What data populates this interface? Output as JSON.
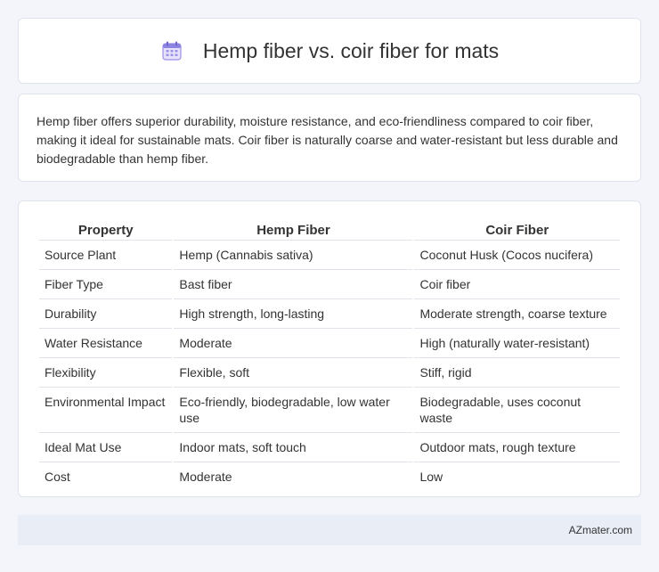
{
  "header": {
    "title": "Hemp fiber vs. coir fiber for mats",
    "icon": "calendar-icon"
  },
  "summary": {
    "text": "Hemp fiber offers superior durability, moisture resistance, and eco-friendliness compared to coir fiber, making it ideal for sustainable mats. Coir fiber is naturally coarse and water-resistant but less durable and biodegradable than hemp fiber."
  },
  "table": {
    "headers": [
      "Property",
      "Hemp Fiber",
      "Coir Fiber"
    ],
    "rows": [
      [
        "Source Plant",
        "Hemp (Cannabis sativa)",
        "Coconut Husk (Cocos nucifera)"
      ],
      [
        "Fiber Type",
        "Bast fiber",
        "Coir fiber"
      ],
      [
        "Durability",
        "High strength, long-lasting",
        "Moderate strength, coarse texture"
      ],
      [
        "Water Resistance",
        "Moderate",
        "High (naturally water-resistant)"
      ],
      [
        "Flexibility",
        "Flexible, soft",
        "Stiff, rigid"
      ],
      [
        "Environmental Impact",
        "Eco-friendly, biodegradable, low water use",
        "Biodegradable, uses coconut waste"
      ],
      [
        "Ideal Mat Use",
        "Indoor mats, soft touch",
        "Outdoor mats, rough texture"
      ],
      [
        "Cost",
        "Moderate",
        "Low"
      ]
    ]
  },
  "footer": {
    "brand": "AZmater.com"
  },
  "colors": {
    "background": "#f3f5fa",
    "card": "#ffffff",
    "border": "#dfe3ec",
    "footer_bg": "#e8edf6",
    "icon_accent": "#7b6fd6"
  }
}
